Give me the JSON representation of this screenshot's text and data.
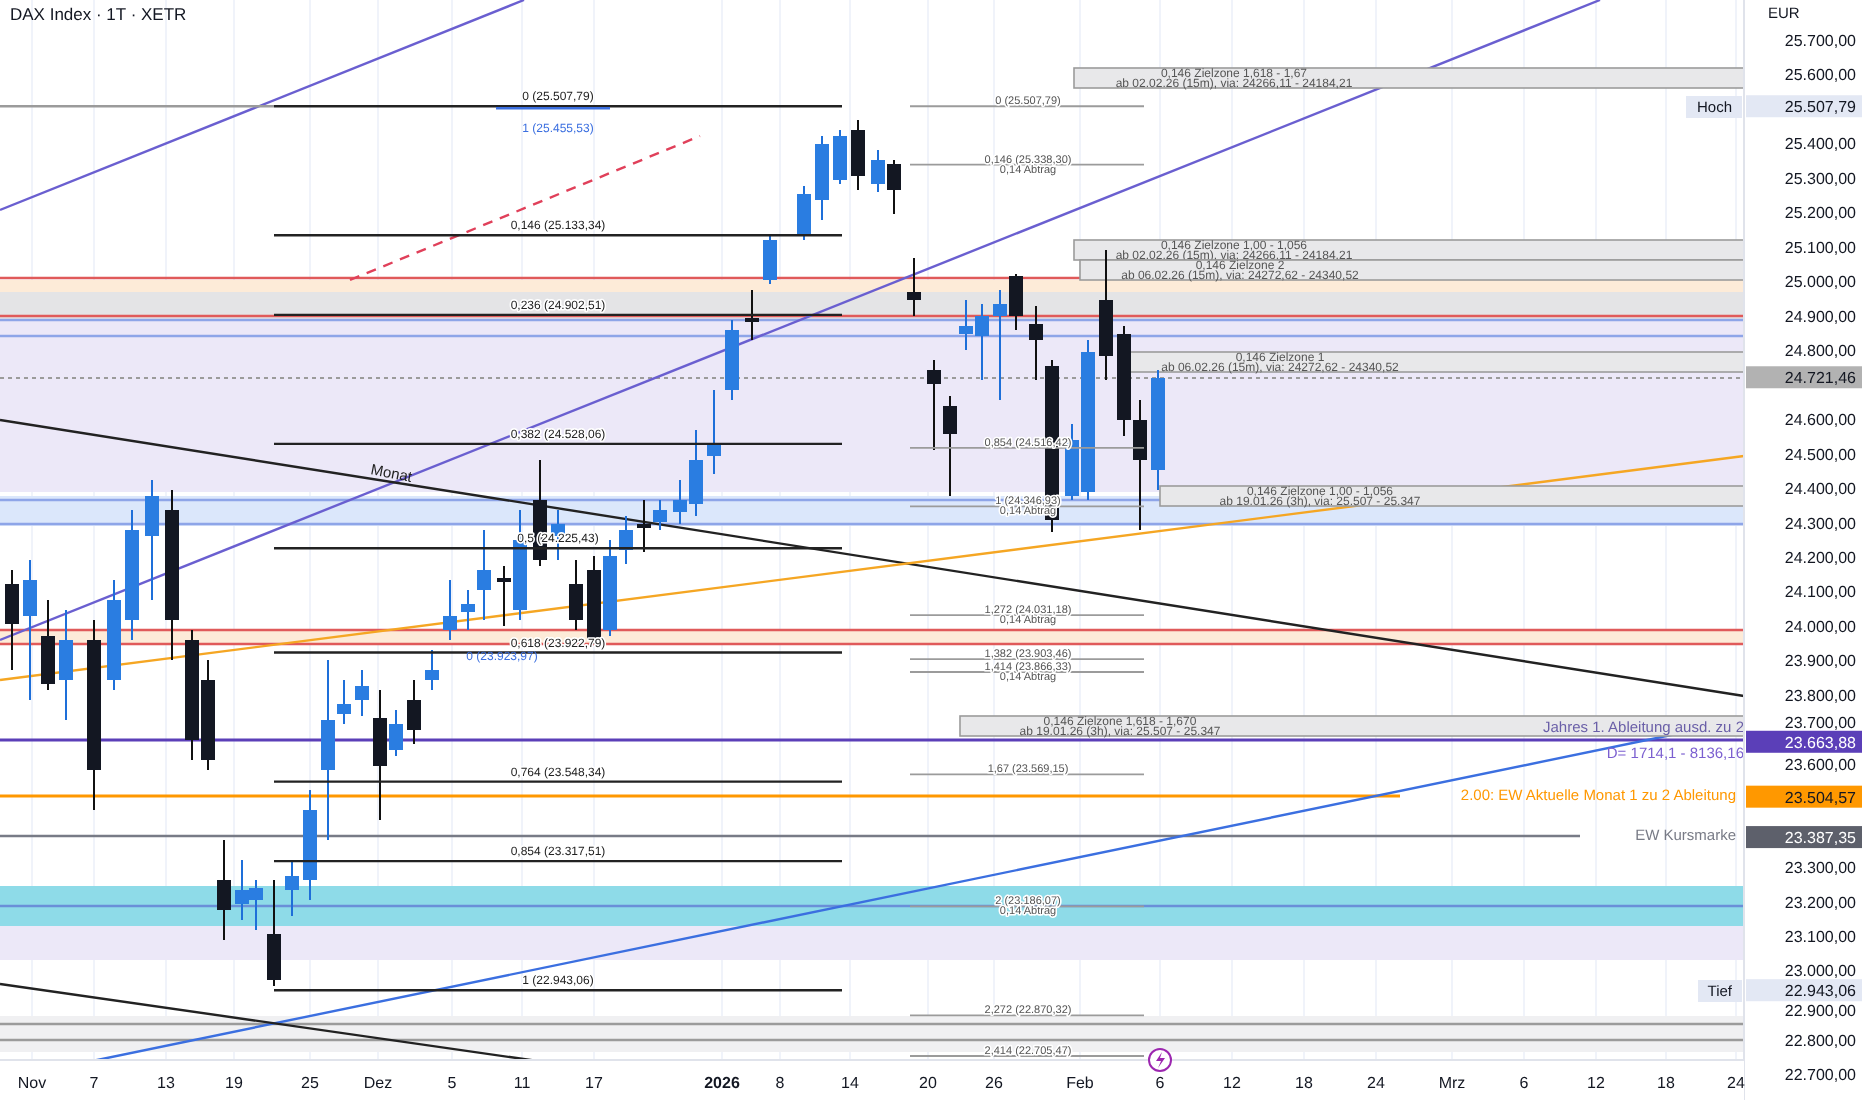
{
  "header": {
    "title": "DAX Index · 1T · XETR"
  },
  "price_axis": {
    "currency": "EUR",
    "ticks": [
      "25.700,00",
      "25.600,00",
      "25.400,00",
      "25.300,00",
      "25.200,00",
      "25.100,00",
      "25.000,00",
      "24.900,00",
      "24.800,00",
      "24.600,00",
      "24.500,00",
      "24.400,00",
      "24.300,00",
      "24.200,00",
      "24.100,00",
      "24.000,00",
      "23.900,00",
      "23.800,00",
      "23.700,00",
      "23.600,00",
      "23.300,00",
      "23.200,00",
      "23.100,00",
      "23.000,00",
      "22.900,00",
      "22.800,00",
      "22.700,00"
    ]
  },
  "price_badges": [
    {
      "tag": "Hoch",
      "price": "25.507,79",
      "color": "#e3e8f4"
    },
    {
      "price": "24.721,46",
      "color": "#b2b2b2"
    },
    {
      "price": "23.663,88",
      "color": "#5b3fb8"
    },
    {
      "price": "23.504,57",
      "color": "#ff9800"
    },
    {
      "price": "23.387,35",
      "color": "#5d606b"
    },
    {
      "tag": "Tief",
      "price": "22.943,06",
      "color": "#e3e8f4"
    }
  ],
  "time_axis": {
    "ticks": [
      "Nov",
      "7",
      "13",
      "19",
      "25",
      "Dez",
      "5",
      "11",
      "17",
      "2026",
      "8",
      "14",
      "20",
      "26",
      "Feb",
      "6",
      "12",
      "18",
      "24",
      "Mrz",
      "6",
      "12",
      "18",
      "24"
    ]
  },
  "fib_main": [
    {
      "label": "0 (25.507,79)"
    },
    {
      "label": "0,146 (25.133,34)"
    },
    {
      "label": "0,236 (24.902,51)"
    },
    {
      "label": "0,382 (24.528,06)"
    },
    {
      "label": "0,5 (24.225,43)"
    },
    {
      "label": "0,618 (23.922,79)"
    },
    {
      "label": "0,764 (23.548,34)"
    },
    {
      "label": "0,854 (23.317,51)"
    },
    {
      "label": "1 (22.943,06)"
    }
  ],
  "fib_secondary": [
    {
      "label": "1 (25.455,53)"
    },
    {
      "label": "0 (23.923,97)"
    }
  ],
  "fib_target": [
    {
      "kind": "level",
      "label": "0 (25.507,79)"
    },
    {
      "kind": "level",
      "label": "0,146 (25.338,30)"
    },
    {
      "kind": "note",
      "label": "0,14 Abtrag"
    },
    {
      "kind": "level",
      "label": "0,854 (24.516,42)"
    },
    {
      "kind": "level",
      "label": "1 (24.346,93)"
    },
    {
      "kind": "note",
      "label": "0,14 Abtrag"
    },
    {
      "kind": "level",
      "label": "1,272 (24.031,18)"
    },
    {
      "kind": "note",
      "label": "0,14 Abtrag"
    },
    {
      "kind": "level",
      "label": "1,382 (23.903,46)"
    },
    {
      "kind": "level",
      "label": "1,414 (23.866,33)"
    },
    {
      "kind": "note",
      "label": "0,14 Abtrag"
    },
    {
      "kind": "level",
      "label": "1,67 (23.569,15)"
    },
    {
      "kind": "level",
      "label": "2 (23.186,07)"
    },
    {
      "kind": "note",
      "label": "0,14 Abtrag"
    },
    {
      "kind": "level",
      "label": "2,272 (22.870,32)"
    },
    {
      "kind": "level",
      "label": "2,414 (22.705,47)"
    }
  ],
  "target_zones": [
    {
      "title": "0,146 Zielzone 1,618 - 1,67",
      "detail": "ab 02.02.26 (15m), via: 24266,11 - 24184,21"
    },
    {
      "title": "0,146 Zielzone 1,00 - 1,056",
      "detail": "ab 02.02.26 (15m), via: 24266,11 - 24184,21"
    },
    {
      "title": "0,146 Zielzone 2",
      "detail": "ab 06.02.26 (15m), via: 24272,62 - 24340,52"
    },
    {
      "title": "0,146 Zielzone 1",
      "detail": "ab 06.02.26 (15m), via: 24272,62 - 24340,52"
    },
    {
      "title": "0,146 Zielzone 1,00 - 1,056",
      "detail": "ab 19.01.26 (3h), via: 25.507 - 25.347"
    },
    {
      "title": "0,146 Zielzone 1,618 - 1,670",
      "detail": "ab 19.01.26 (3h), via: 25.507 - 25.347"
    }
  ],
  "line_labels": [
    {
      "text": "Jahres 1. Ableitung ausd. zu 2",
      "color": "#6a5fa8"
    },
    {
      "text": "D= 1714,1 - 8136,16",
      "color": "#7b5fd0"
    },
    {
      "text": "2.00: EW Aktuelle Monat 1 zu 2 Ableitung",
      "color": "#ff9800"
    },
    {
      "text": "EW Kursmarke",
      "color": "#787b86"
    }
  ],
  "trend_label": {
    "text": "Monat"
  }
}
